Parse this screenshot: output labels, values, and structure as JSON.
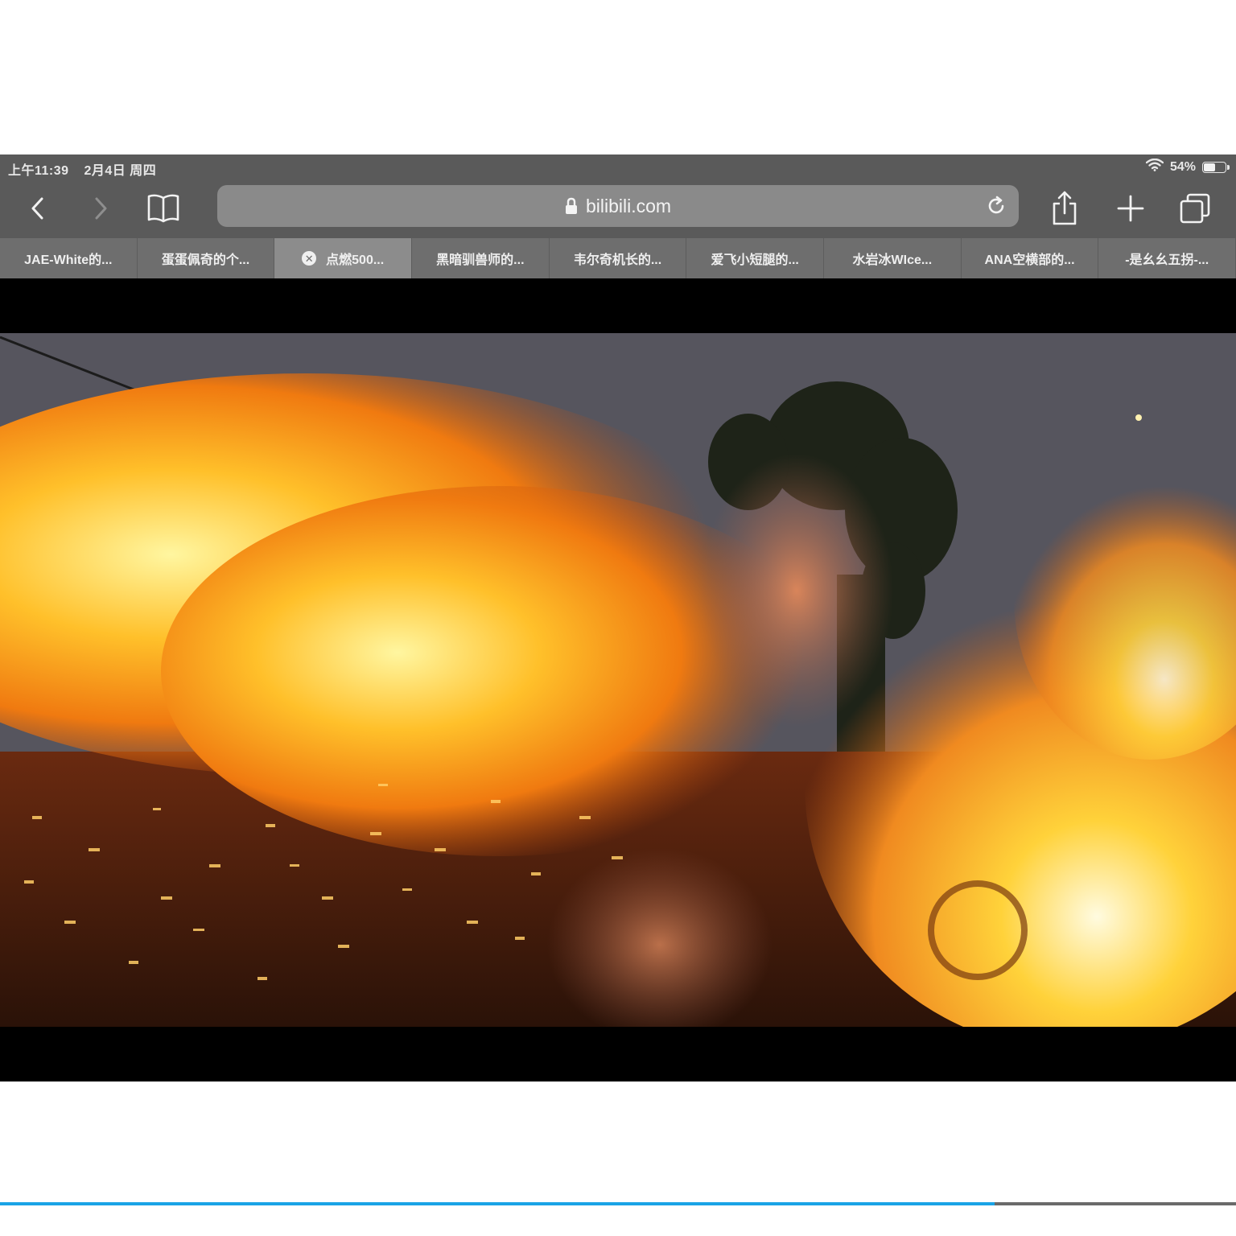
{
  "status_bar": {
    "time": "上午11:39",
    "date": "2月4日 周四",
    "battery_percent": "54%",
    "battery_level": 0.54
  },
  "toolbar": {
    "url": "bilibili.com",
    "icons": [
      "chevron-left-icon",
      "chevron-right-icon",
      "bookmarks-book-icon",
      "lock-icon",
      "reload-icon",
      "share-icon",
      "plus-icon",
      "tabs-icon"
    ]
  },
  "tabs": [
    {
      "label": "JAE-White的...",
      "active": false
    },
    {
      "label": "蛋蛋佩奇的个...",
      "active": false
    },
    {
      "label": "点燃500...",
      "active": true
    },
    {
      "label": "黑暗驯兽师的...",
      "active": false
    },
    {
      "label": "韦尔奇机长的...",
      "active": false
    },
    {
      "label": "爱飞小短腿的...",
      "active": false
    },
    {
      "label": "水岩冰WIce...",
      "active": false
    },
    {
      "label": "ANA空横部的...",
      "active": false
    },
    {
      "label": "-是幺幺五拐-...",
      "active": false
    }
  ],
  "video": {
    "progress": 0.805
  },
  "colors": {
    "chrome_gray": "#5a5a5a",
    "tab_gray": "#6e6e6e",
    "progress_blue": "#1aa3e6"
  }
}
